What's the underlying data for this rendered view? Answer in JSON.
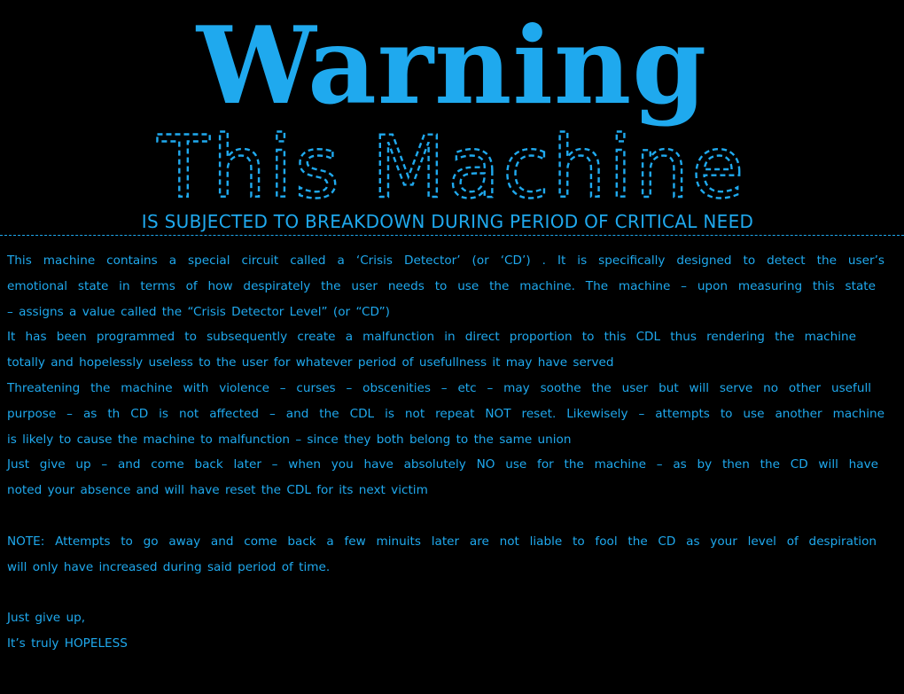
{
  "heading": {
    "title": "Warning",
    "subtitle": "This Machine",
    "tagline": "IS SUBJECTED TO BREAKDOWN DURING PERIOD OF CRITICAL NEED"
  },
  "lines": [
    "This machine contains a special circuit called a ‘Crisis Detector’ (or ‘CD’) . It is specifically designed to detect the user’s",
    "emotional state in terms of how despirately the user needs to use the machine. The machine – upon measuring this state",
    "– assigns a value called the “Crisis Detector Level” (or “CD”)",
    "It has been programmed to subsequently create a malfunction in direct proportion to this CDL thus rendering the machine",
    "totally and hopelessly useless to the user for whatever period of usefullness it may have served",
    "Threatening the machine with violence – curses – obscenities – etc – may soothe the user but will serve no other usefull",
    "purpose – as th CD is not affected – and the CDL is not repeat NOT reset. Likewisely – attempts to use another machine",
    "is likely to cause the machine to malfunction – since they both belong to the same union",
    "Just give up – and come back later – when you have absolutely NO use for the machine – as by then the CD will have",
    "noted your absence and will have reset the CDL for its next victim",
    "",
    "NOTE:  Attempts to go away and come back a few minuits later are not liable to fool the CD as your level of despiration",
    "will only have increased during said period of time.",
    "",
    "Just give up,",
    "It’s truly HOPELESS"
  ],
  "colors": {
    "background": "#000000",
    "text": "#1fa9ee"
  }
}
